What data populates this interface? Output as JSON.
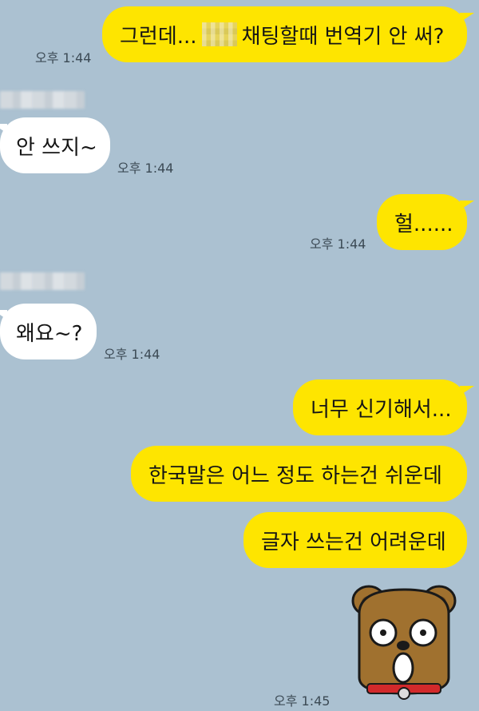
{
  "chat": {
    "m1": {
      "pre": "그런데...",
      "post": "채팅할때 번역기 안 써?",
      "time": "오후 1:44"
    },
    "m2": {
      "text": "안 쓰지~",
      "time": "오후 1:44"
    },
    "m3": {
      "text": "헐......",
      "time": "오후 1:44"
    },
    "m4": {
      "text": "왜요~?",
      "time": "오후 1:44"
    },
    "m5": {
      "text": "너무 신기해서..."
    },
    "m6": {
      "text": "한국말은 어느 정도 하는건 쉬운데"
    },
    "m7": {
      "text": "글자 쓰는건 어려운데",
      "time": "오후 1:45"
    }
  },
  "sticker": {
    "icon": "bear-surprised-icon"
  },
  "colors": {
    "background": "#abc1d1",
    "my_bubble": "#fee500",
    "other_bubble": "#ffffff"
  }
}
